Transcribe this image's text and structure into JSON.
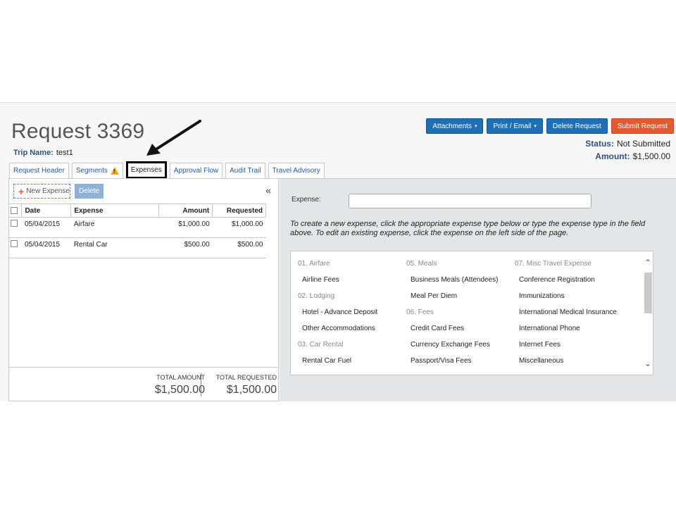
{
  "header": {
    "title": "Request 3369",
    "trip_label": "Trip Name:",
    "trip_value": "test1",
    "status_label": "Status:",
    "status_value": "Not Submitted",
    "amount_label": "Amount:",
    "amount_value": "$1,500.00"
  },
  "toolbar": {
    "attachments": "Attachments",
    "print_email": "Print / Email",
    "delete_request": "Delete Request",
    "submit_request": "Submit Request",
    "caret": "▾"
  },
  "tabs": [
    {
      "label": "Request Header"
    },
    {
      "label": "Segments"
    },
    {
      "label": "Expenses"
    },
    {
      "label": "Approval Flow"
    },
    {
      "label": "Audit Trail"
    },
    {
      "label": "Travel Advisory"
    }
  ],
  "expenses_panel": {
    "new_expense": "New Expense",
    "delete": "Delete",
    "collapse": "«",
    "columns": [
      "Date",
      "Expense",
      "Amount",
      "Requested"
    ],
    "rows": [
      {
        "date": "05/04/2015",
        "expense": "Airfare",
        "amount": "$1,000.00",
        "requested": "$1,000.00"
      },
      {
        "date": "05/04/2015",
        "expense": "Rental Car",
        "amount": "$500.00",
        "requested": "$500.00"
      }
    ],
    "total_amount_label": "TOTAL AMOUNT",
    "total_amount_value": "$1,500.00",
    "total_requested_label": "TOTAL REQUESTED",
    "total_requested_value": "$1,500.00"
  },
  "detail_panel": {
    "expense_label": "Expense:",
    "expense_value": "",
    "instructions": "To create a new expense, click the appropriate expense type below or type the expense type in the field above. To edit an existing expense, click the expense on the left side of the page.",
    "col1": {
      "g1": "01. Airfare",
      "i1": "Airline Fees",
      "g2": "02. Lodging",
      "i2": "Hotel - Advance Deposit",
      "i3": "Other Accommodations",
      "g3": "03. Car Rental",
      "i4": "Rental Car Fuel"
    },
    "col2": {
      "g1": "05. Meals",
      "i1": "Business Meals (Attendees)",
      "i2": "Meal Per Diem",
      "g2": "06. Fees",
      "i3": "Credit Card Fees",
      "i4": "Currency Exchange Fees",
      "i5": "Passport/Visa Fees"
    },
    "col3": {
      "g1": "07. Misc Travel Expense",
      "i1": "Conference Registration",
      "i2": "Immunizations",
      "i3": "International Medical Insurance",
      "i4": "International Phone",
      "i5": "Internet Fees",
      "i6": "Miscellaneous"
    }
  },
  "icons": {
    "warning": "warning-icon",
    "plus": "plus-icon",
    "scroll_up": "chevron-up-icon",
    "scroll_down": "chevron-down-icon"
  },
  "colors": {
    "primary_button": "#1f6fb5",
    "submit_button": "#e05a32",
    "label_blue": "#34507a",
    "warning": "#f0a81c"
  }
}
